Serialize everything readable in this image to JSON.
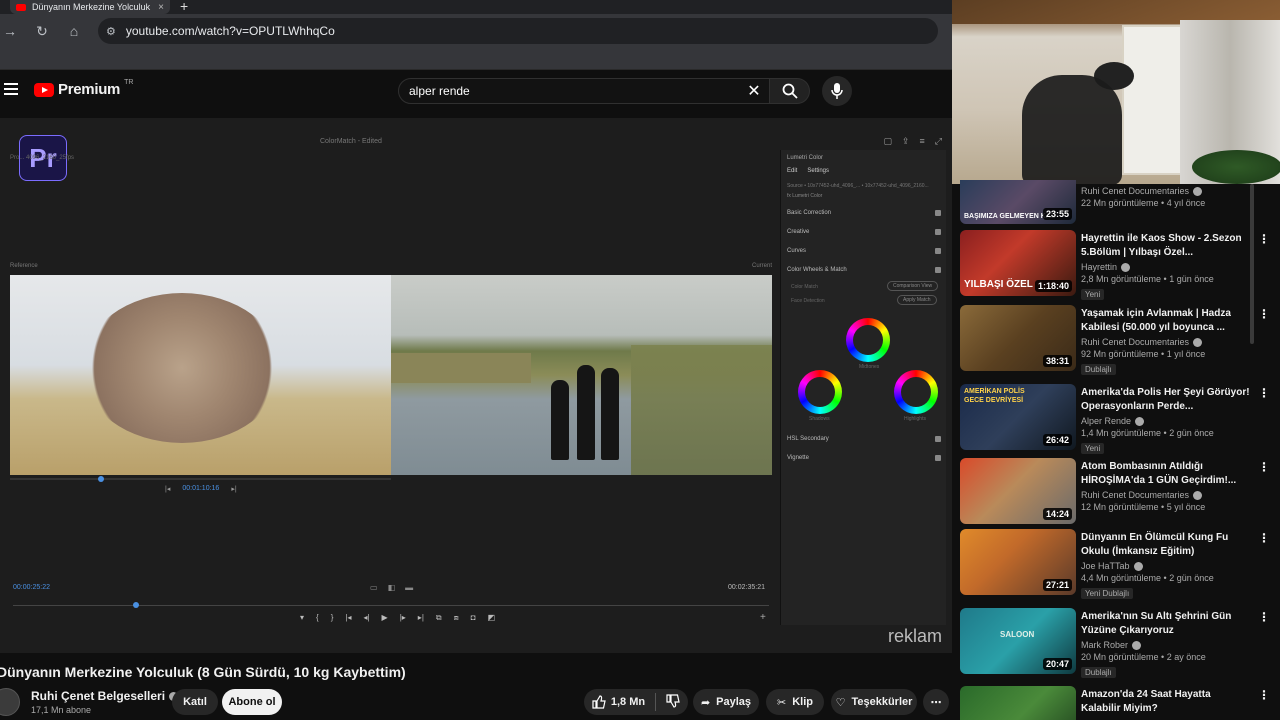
{
  "browser": {
    "tab_title": "Dünyanın Merkezine Yolculuk (",
    "tab_close": "×",
    "new_tab": "+",
    "url": "youtube.com/watch?v=OPUTLWhhqCo"
  },
  "youtube": {
    "logo_text": "Premium",
    "logo_region": "TR",
    "search_value": "alper rende"
  },
  "player": {
    "premiere_logo": "Pr",
    "premiere_title": "ColorMatch - Edited",
    "sequence_label": "Pro... 4096_2160_25fps",
    "reference_label": "Reference",
    "current_label": "Current",
    "mid_timecode": "00:01:10:16",
    "timecode_left": "00:00:25:22",
    "timecode_right": "00:02:35:21",
    "lumetri": {
      "title": "Lumetri Color",
      "tab_edit": "Edit",
      "tab_settings": "Settings",
      "source": "Source • 10x77452-uhd_4096_... • 10x77452-uhd_4096_2160...",
      "fx": "fx  Lumetri Color",
      "sections": [
        "Basic Correction",
        "Creative",
        "Curves",
        "Color Wheels & Match"
      ],
      "color_match": "Color Match",
      "comparison_view": "Comparison View",
      "face_detection": "Face Detection",
      "apply_match": "Apply Match",
      "midtones": "Midtones",
      "shadows": "Shadows",
      "highlights": "Highlights",
      "hsl_secondary": "HSL Secondary",
      "vignette": "Vignette"
    },
    "ad_label": "reklam"
  },
  "video": {
    "title": "Dünyanın Merkezine Yolculuk (8 Gün Sürdü, 10 kg Kaybettim)",
    "channel": "Ruhi Çenet Belgeselleri",
    "subscribers": "17,1 Mn abone",
    "join": "Katıl",
    "subscribe": "Abone ol",
    "likes": "1,8 Mn",
    "share": "Paylaş",
    "clip": "Klip",
    "thanks": "Teşekkürler",
    "more": "⋯"
  },
  "sidebar": {
    "items": [
      {
        "title": "",
        "channel": "Ruhi Cenet Documentaries",
        "views": "22 Mn görüntüleme • 4 yıl önce",
        "duration": "23:55",
        "badge": "",
        "thumb_text": "BAŞIMIZA GELMEYEN KAL"
      },
      {
        "title": "Hayrettin ile Kaos Show - 2.Sezon 5.Bölüm | Yılbaşı Özel...",
        "channel": "Hayrettin",
        "views": "2,8 Mn görüntüleme • 1 gün önce",
        "duration": "1:18:40",
        "badge": "Yeni",
        "thumb_text": "YILBAŞI ÖZEL"
      },
      {
        "title": "Yaşamak için Avlanmak | Hadza Kabilesi (50.000 yıl boyunca ...",
        "channel": "Ruhi Cenet Documentaries",
        "views": "92 Mn görüntüleme • 1 yıl önce",
        "duration": "38:31",
        "badge": "Dublajlı",
        "thumb_text": ""
      },
      {
        "title": "Amerika'da Polis Her Şeyi Görüyor! Operasyonların Perde...",
        "channel": "Alper Rende",
        "views": "1,4 Mn görüntüleme • 2 gün önce",
        "duration": "26:42",
        "badge": "Yeni",
        "thumb_text": "AMERİKAN POLİS GECE DEVRİYESİ"
      },
      {
        "title": "Atom Bombasının Atıldığı HİROŞİMA'da 1 GÜN Geçirdim!...",
        "channel": "Ruhi Cenet Documentaries",
        "views": "12 Mn görüntüleme • 5 yıl önce",
        "duration": "14:24",
        "badge": "",
        "thumb_text": ""
      },
      {
        "title": "Dünyanın En Ölümcül Kung Fu Okulu (İmkansız Eğitim)",
        "channel": "Joe HaTTab",
        "views": "4,4 Mn görüntüleme • 2 gün önce",
        "duration": "27:21",
        "badge": "Yeni  Dublajlı",
        "thumb_text": ""
      },
      {
        "title": "Amerika'nın Su Altı Şehrini Gün Yüzüne Çıkarıyoruz",
        "channel": "Mark Rober",
        "views": "20 Mn görüntüleme • 2 ay önce",
        "duration": "20:47",
        "badge": "Dublajlı",
        "thumb_text": "SALOON"
      },
      {
        "title": "Amazon'da 24 Saat Hayatta Kalabilir Miyim?",
        "channel": "",
        "views": "",
        "duration": "",
        "badge": "",
        "thumb_text": ""
      }
    ]
  },
  "colors": {
    "youtube_red": "#ff0000",
    "premiere_purple": "#7b6cff",
    "timecode_blue": "#4a90e2"
  }
}
